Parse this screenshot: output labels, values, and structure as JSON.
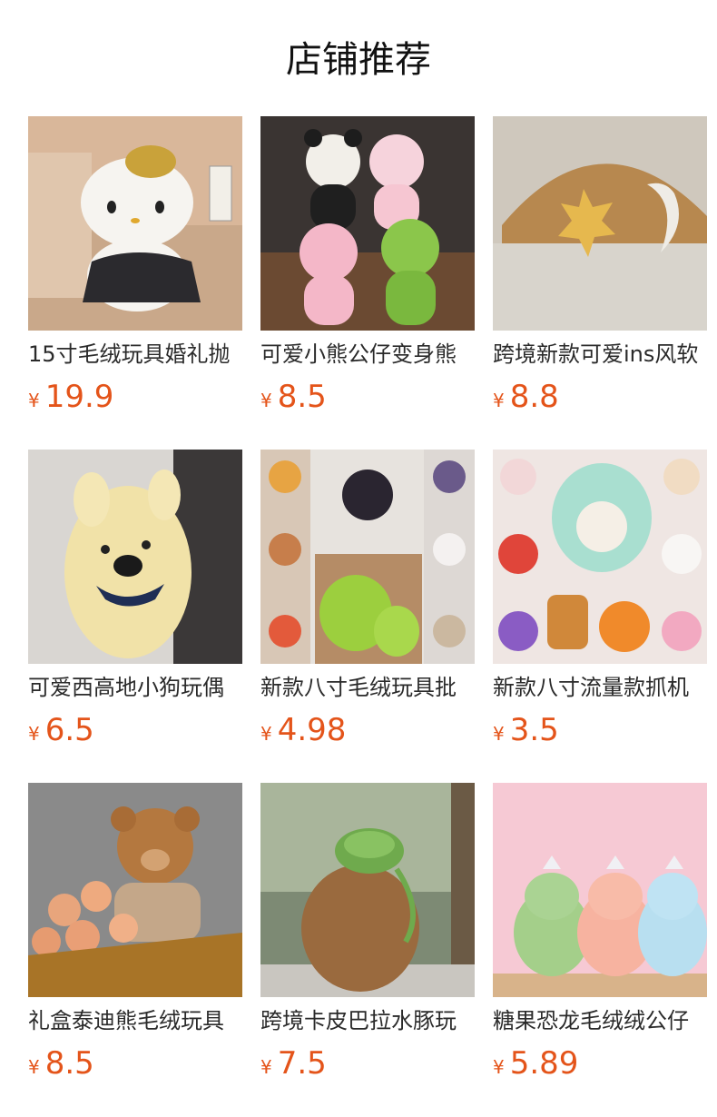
{
  "section": {
    "title": "店铺推荐"
  },
  "currency_symbol": "¥",
  "products": [
    {
      "name": "15寸毛绒玩具婚礼抛",
      "price": "19.9",
      "image": "hello-kitty-plush"
    },
    {
      "name": "可爱小熊公仔变身熊",
      "price": "8.5",
      "image": "costume-bear-plush"
    },
    {
      "name": "跨境新款可爱ins风软",
      "price": "8.8",
      "image": "sun-moon-plush"
    },
    {
      "name": "可爱西高地小狗玩偶",
      "price": "6.5",
      "image": "westie-dog-plush"
    },
    {
      "name": "新款八寸毛绒玩具批",
      "price": "4.98",
      "image": "capybara-collage"
    },
    {
      "name": "新款八寸流量款抓机",
      "price": "3.5",
      "image": "character-collage"
    },
    {
      "name": "礼盒泰迪熊毛绒玩具",
      "price": "8.5",
      "image": "teddy-bear-roses"
    },
    {
      "name": "跨境卡皮巴拉水豚玩",
      "price": "7.5",
      "image": "capybara-turtle-plush"
    },
    {
      "name": "糖果恐龙毛绒绒公仔",
      "price": "5.89",
      "image": "candy-dinosaur-plush"
    }
  ],
  "colors": {
    "price": "#e4541a",
    "title": "#111111",
    "name": "#2a2a2a"
  }
}
